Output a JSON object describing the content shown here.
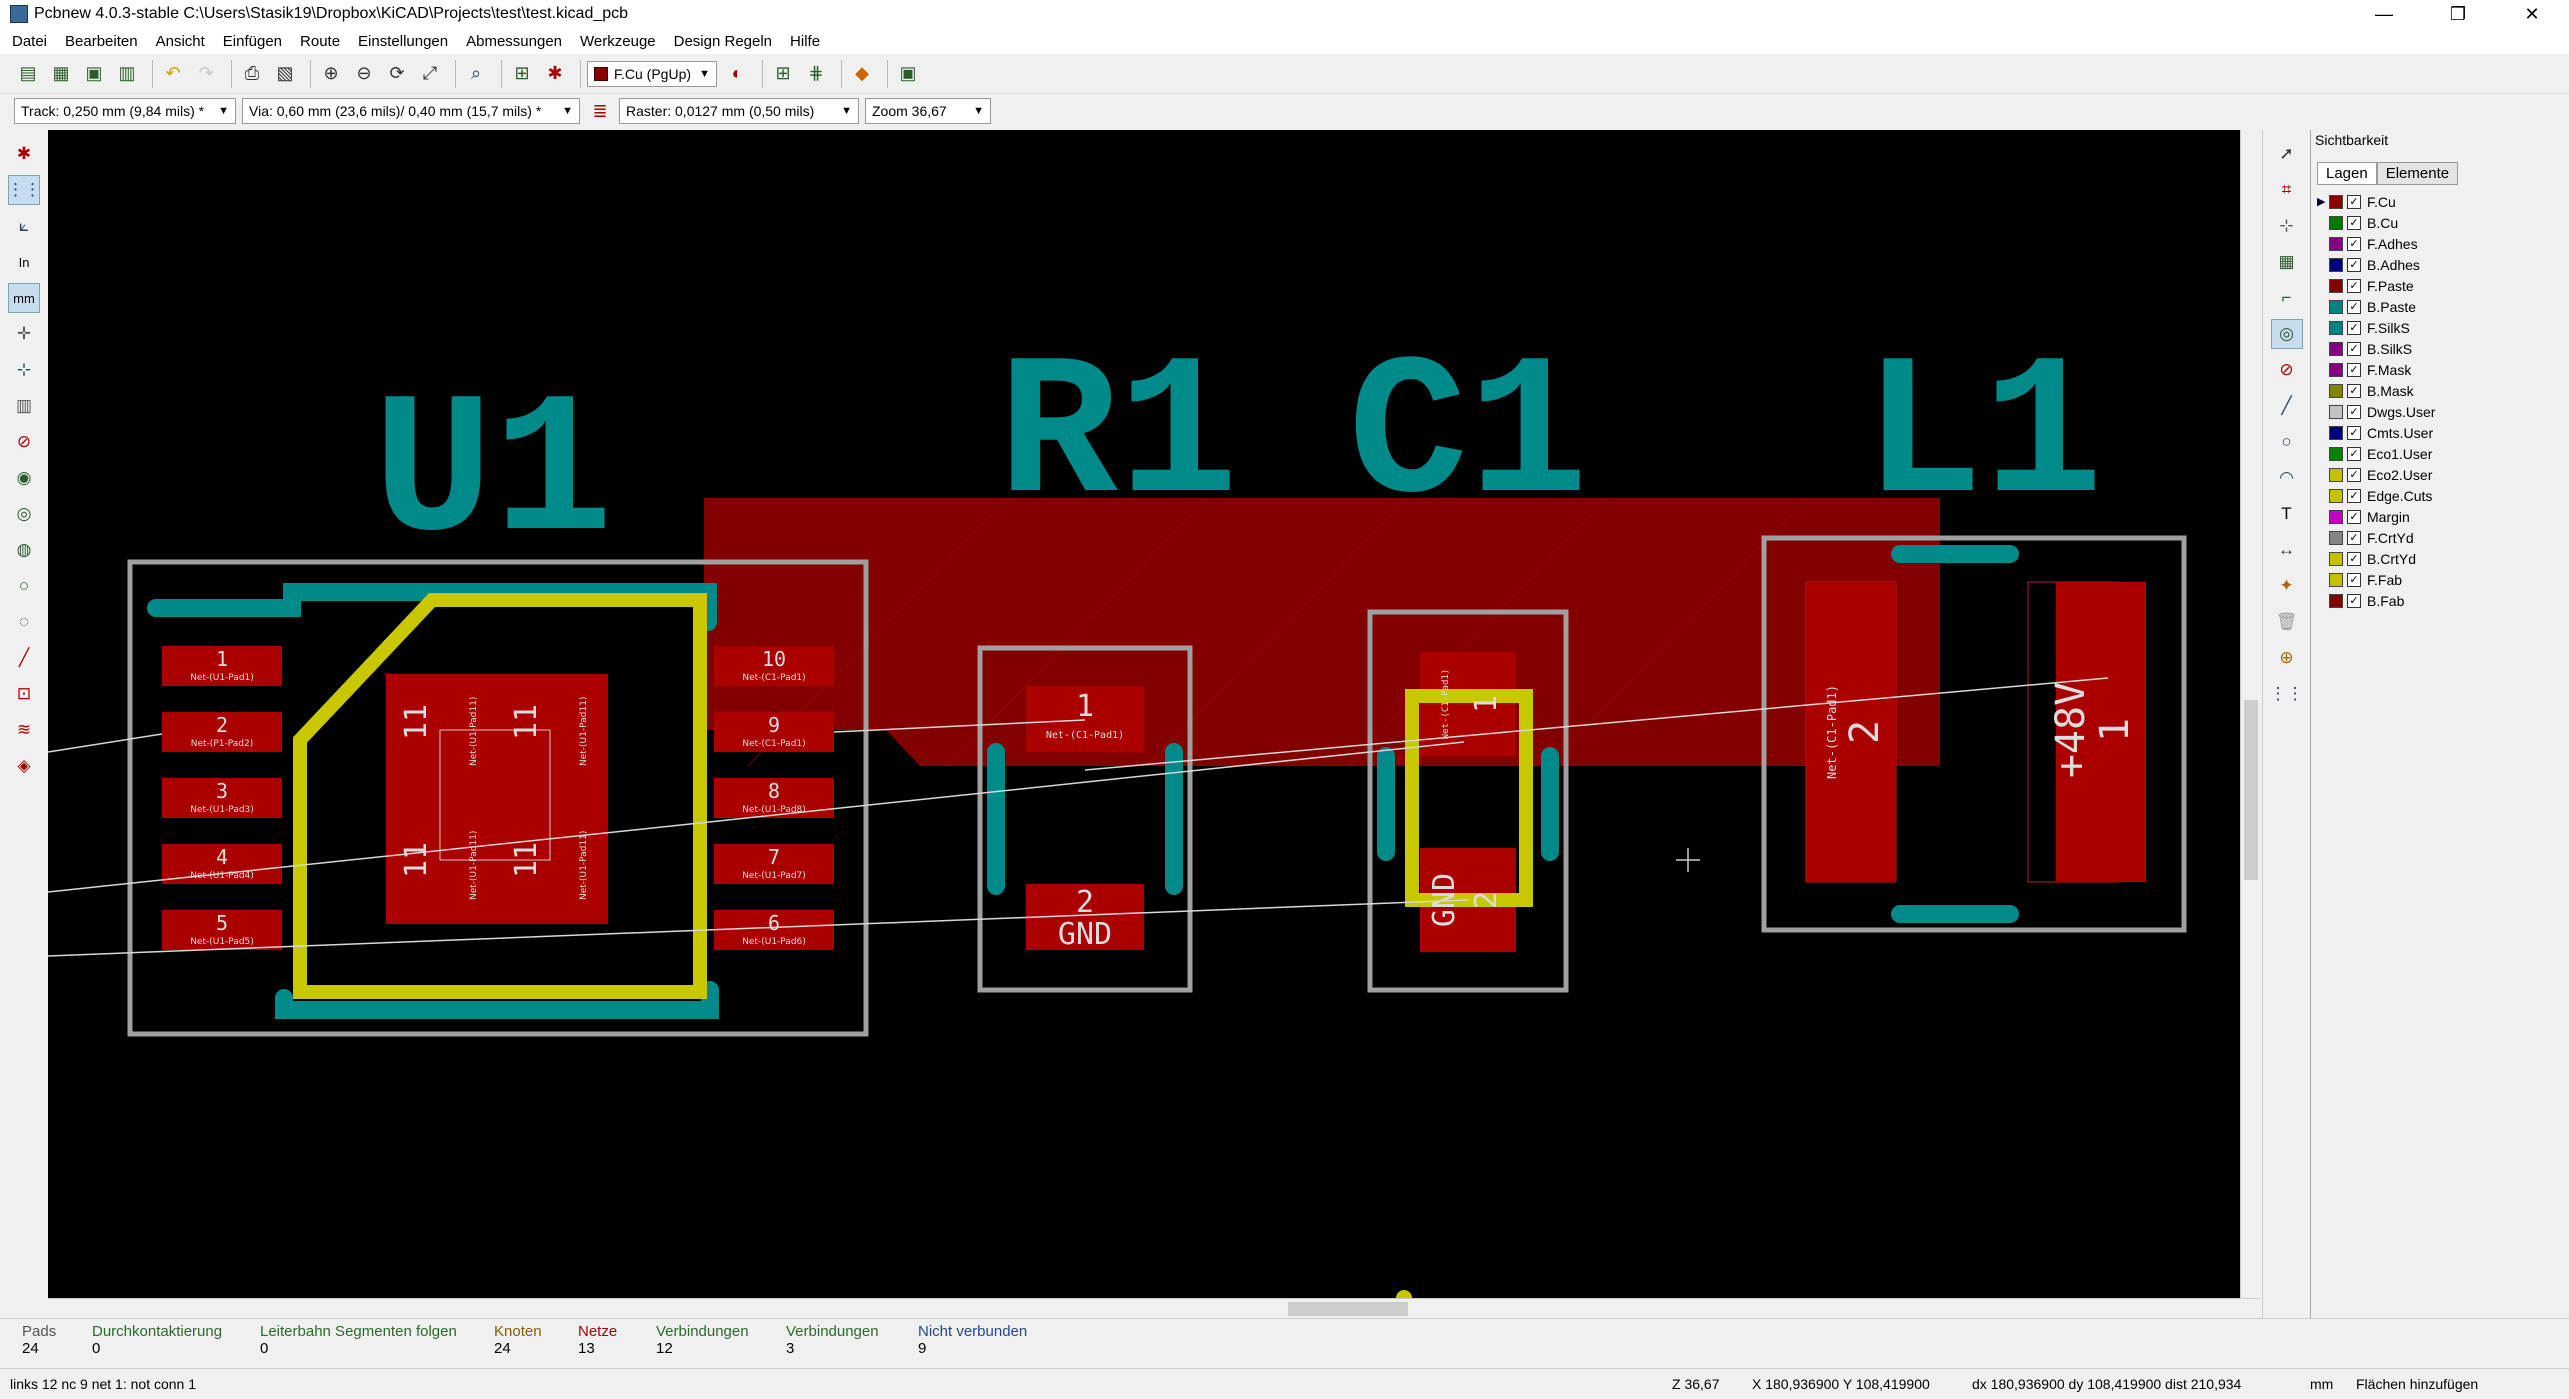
{
  "window": {
    "title": "Pcbnew 4.0.3-stable C:\\Users\\Stasik19\\Dropbox\\KiCAD\\Projects\\test\\test.kicad_pcb",
    "controls": [
      "—",
      "❐",
      "✕"
    ]
  },
  "menu": [
    "Datei",
    "Bearbeiten",
    "Ansicht",
    "Einfügen",
    "Route",
    "Einstellungen",
    "Abmessungen",
    "Werkzeuge",
    "Design Regeln",
    "Hilfe"
  ],
  "toolbar": {
    "layer_select": "F.Cu (PgUp)",
    "layer_color": "#8a0000",
    "track": "Track: 0,250 mm (9,84 mils) *",
    "via": "Via: 0,60 mm (23,6 mils)/ 0,40 mm (15,7 mils) *",
    "raster": "Raster: 0,0127 mm (0,50 mils)",
    "zoom": "Zoom 36,67"
  },
  "panel": {
    "title": "Sichtbarkeit",
    "tabs": [
      "Lagen",
      "Elemente"
    ],
    "layers": [
      {
        "name": "F.Cu",
        "color": "#8a0000"
      },
      {
        "name": "B.Cu",
        "color": "#007a00"
      },
      {
        "name": "F.Adhes",
        "color": "#840084"
      },
      {
        "name": "B.Adhes",
        "color": "#000084"
      },
      {
        "name": "F.Paste",
        "color": "#840000"
      },
      {
        "name": "B.Paste",
        "color": "#008484"
      },
      {
        "name": "F.SilkS",
        "color": "#008484"
      },
      {
        "name": "B.SilkS",
        "color": "#840084"
      },
      {
        "name": "F.Mask",
        "color": "#840084"
      },
      {
        "name": "B.Mask",
        "color": "#848400"
      },
      {
        "name": "Dwgs.User",
        "color": "#c2c2c2"
      },
      {
        "name": "Cmts.User",
        "color": "#000084"
      },
      {
        "name": "Eco1.User",
        "color": "#008400"
      },
      {
        "name": "Eco2.User",
        "color": "#c2c200"
      },
      {
        "name": "Edge.Cuts",
        "color": "#c2c200"
      },
      {
        "name": "Margin",
        "color": "#c200c2"
      },
      {
        "name": "F.CrtYd",
        "color": "#848484"
      },
      {
        "name": "B.CrtYd",
        "color": "#c2c200"
      },
      {
        "name": "F.Fab",
        "color": "#c2c200"
      },
      {
        "name": "B.Fab",
        "color": "#840000"
      }
    ]
  },
  "pcb": {
    "refs": {
      "u1": "U1",
      "r1": "R1",
      "c1": "C1",
      "l1": "L1"
    },
    "u1_pins_left": [
      {
        "num": "1",
        "net": "Net-(U1-Pad1)"
      },
      {
        "num": "2",
        "net": "Net-(P1-Pad2)"
      },
      {
        "num": "3",
        "net": "Net-(U1-Pad3)"
      },
      {
        "num": "4",
        "net": "Net-(U1-Pad4)"
      },
      {
        "num": "5",
        "net": "Net-(U1-Pad5)"
      }
    ],
    "u1_pins_right": [
      {
        "num": "10",
        "net": "Net-(C1-Pad1)"
      },
      {
        "num": "9",
        "net": "Net-(C1-Pad1)"
      },
      {
        "num": "8",
        "net": "Net-(U1-Pad8)"
      },
      {
        "num": "7",
        "net": "Net-(U1-Pad7)"
      },
      {
        "num": "6",
        "net": "Net-(U1-Pad6)"
      }
    ],
    "u1_center_num": "11",
    "u1_center_net": "Net-(U1-Pad11)",
    "r1_pad1_num": "1",
    "r1_pad1_net": "Net-(C1-Pad1)",
    "r1_pad2_num": "2",
    "r1_pad2_net": "GND",
    "c1_pad1_num": "1",
    "c1_pad1_net": "Net-(C1-Pad1)",
    "c1_pad2_num": "2",
    "c1_pad2_net": "GND",
    "l1_pad2_num": "2",
    "l1_pad2_net": "Net-(C1-Pad1)",
    "l1_pad1_num": "1",
    "l1_pad1_net": "+48V"
  },
  "status": {
    "pads_label": "Pads",
    "pads_val": "24",
    "vias_label": "Durchkontaktierung",
    "vias_val": "0",
    "track_label": "Leiterbahn Segmenten folgen",
    "track_val": "0",
    "nodes_label": "Knoten",
    "nodes_val": "24",
    "nets_label": "Netze",
    "nets_val": "13",
    "conn_label": "Verbindungen",
    "conn_val": "12",
    "conn2_label": "Verbindungen",
    "conn2_val": "3",
    "unconn_label": "Nicht verbunden",
    "unconn_val": "9"
  },
  "bottom": {
    "msg": "links 12 nc 9  net 1: not conn 1",
    "zoom": "Z 36,67",
    "xy": "X 180,936900  Y 108,419900",
    "dxy": "dx 180,936900  dy 108,419900  dist 210,934",
    "units": "mm",
    "mode": "Flächen hinzufügen"
  }
}
